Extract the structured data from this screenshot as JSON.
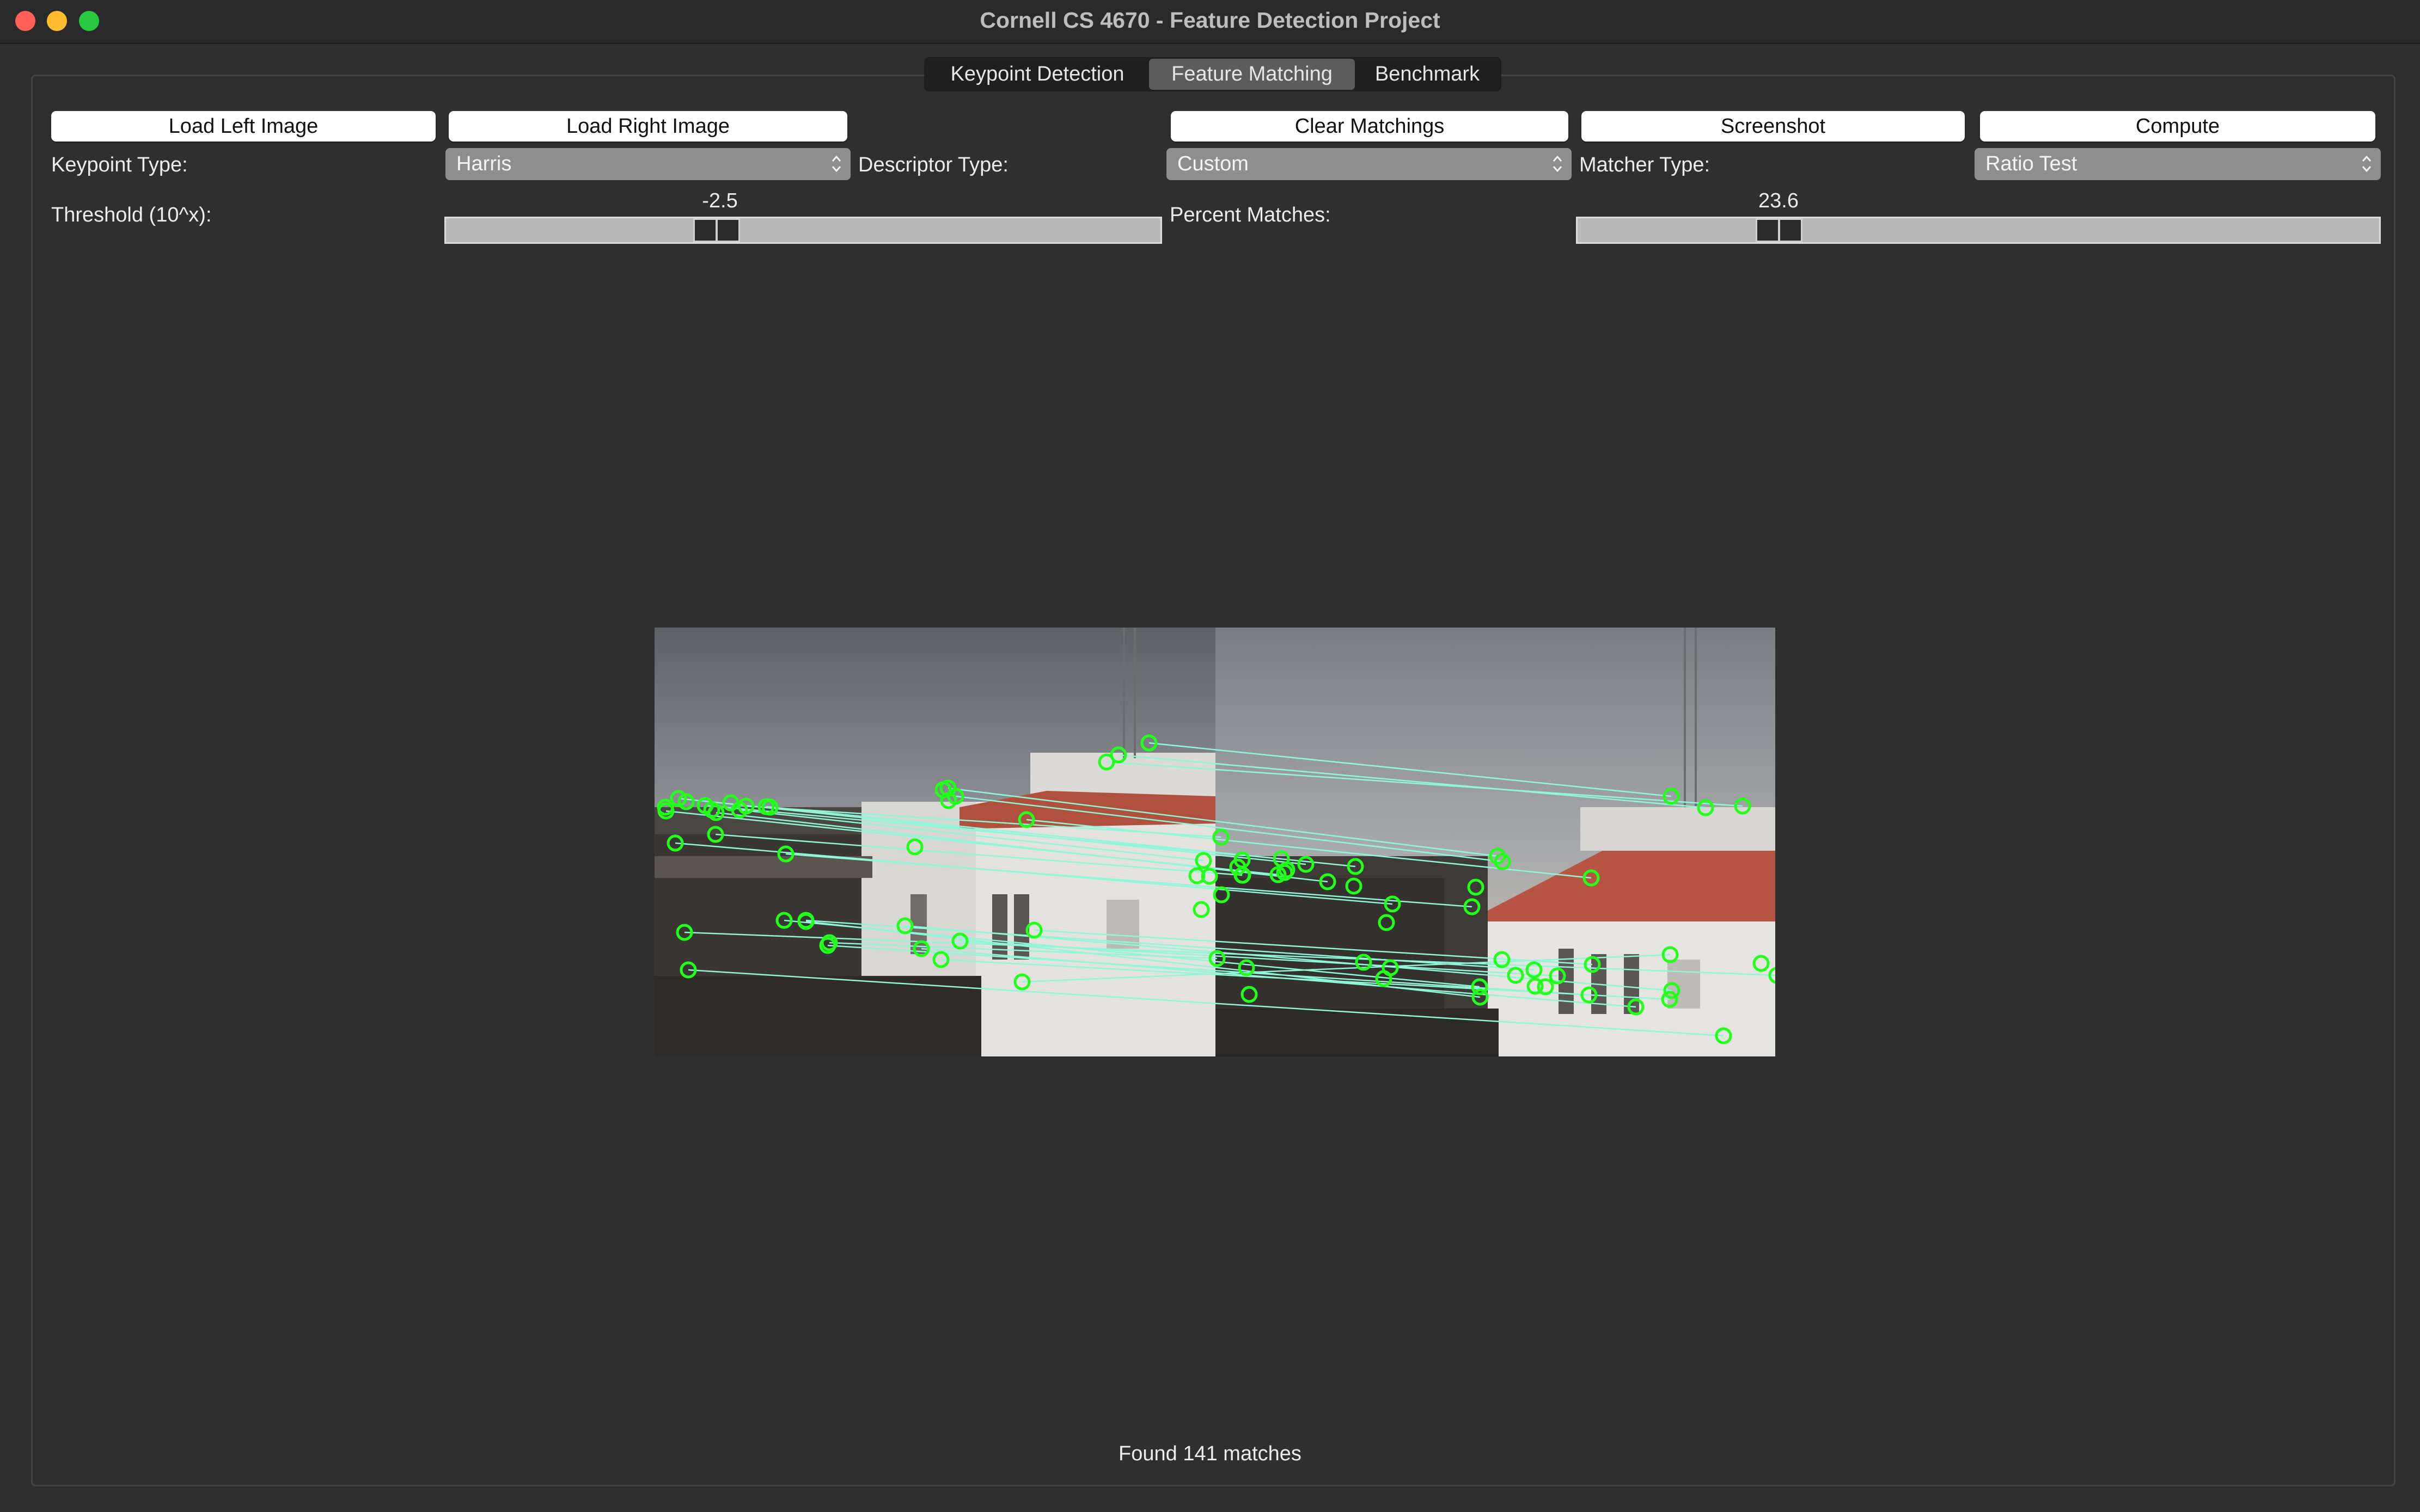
{
  "window": {
    "title": "Cornell CS 4670 - Feature Detection Project"
  },
  "tabs": [
    {
      "label": "Keypoint Detection",
      "active": false
    },
    {
      "label": "Feature Matching",
      "active": true
    },
    {
      "label": "Benchmark",
      "active": false
    }
  ],
  "toolbar": {
    "load_left": "Load Left Image",
    "load_right": "Load Right Image",
    "clear": "Clear Matchings",
    "screenshot": "Screenshot",
    "compute": "Compute"
  },
  "controls": {
    "keypoint_label": "Keypoint Type:",
    "keypoint_value": "Harris",
    "descriptor_label": "Descriptor Type:",
    "descriptor_value": "Custom",
    "matcher_label": "Matcher Type:",
    "matcher_value": "Ratio Test",
    "threshold_label": "Threshold (10^x):",
    "threshold_value": "-2.5",
    "threshold_fraction": 0.37,
    "percent_label": "Percent Matches:",
    "percent_value": "23.6",
    "percent_fraction": 0.236
  },
  "status": {
    "text": "Found 141 matches"
  },
  "colors": {
    "keypoint": "#21ff1a",
    "match_line": "#8ff7d8",
    "select_bg": "#8e8e8e",
    "active_tab": "#5c5c5c"
  }
}
